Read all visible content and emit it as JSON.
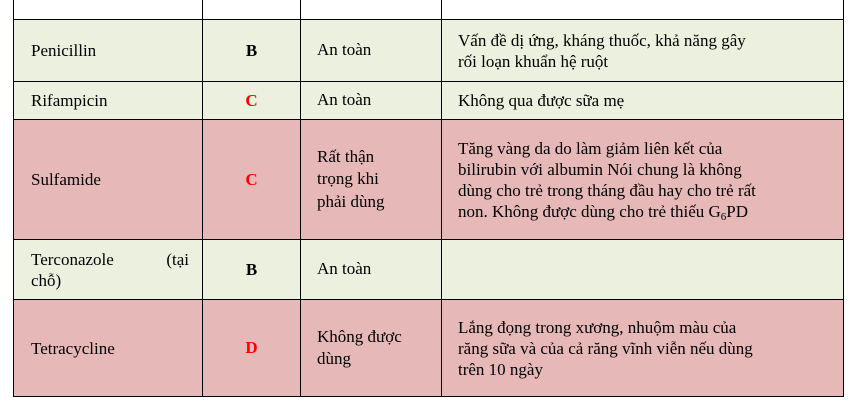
{
  "theme": {
    "green_row": "#ebf1de",
    "pink_row": "#e6b9b8",
    "category_black": "#000000",
    "category_red": "#ff0000"
  },
  "table": {
    "rows": [
      {
        "drug": [
          "Penicillin"
        ],
        "category": "B",
        "category_color": "#000000",
        "safety": [
          "An toàn"
        ],
        "notes": [
          "Vấn đề dị ứng, kháng thuốc, khả năng gây",
          "rối loạn khuẩn hệ ruột"
        ],
        "row_color": "#ebf1de"
      },
      {
        "drug": [
          "Rifampicin"
        ],
        "category": "C",
        "category_color": "#ff0000",
        "safety": [
          "An toàn"
        ],
        "notes": [
          "Không qua được sữa mẹ"
        ],
        "row_color": "#ebf1de"
      },
      {
        "drug": [
          "Sulfamide"
        ],
        "category": "C",
        "category_color": "#ff0000",
        "safety": [
          "Rất thận",
          "trọng khi",
          "phải dùng"
        ],
        "notes": [
          "Tăng vàng da do làm giảm liên kết của",
          "bilirubin với albumin Nói chung là không",
          "dùng cho trẻ trong tháng đầu hay cho trẻ rất",
          "non. Không được dùng cho trẻ thiếu G"
        ],
        "notes_subscript": "6",
        "notes_tail": "PD",
        "row_color": "#e6b9b8"
      },
      {
        "drug": [
          "Terconazole (tại",
          "chỗ)"
        ],
        "category": "B",
        "category_color": "#000000",
        "safety": [
          "An toàn"
        ],
        "notes": [],
        "row_color": "#ebf1de"
      },
      {
        "drug": [
          "Tetracycline"
        ],
        "category": "D",
        "category_color": "#ff0000",
        "safety": [
          "Không được",
          "dùng"
        ],
        "notes": [
          "Lắng đọng trong xương, nhuộm màu của",
          "răng sữa và của cả răng vĩnh viễn nếu dùng",
          "trên 10 ngày"
        ],
        "row_color": "#e6b9b8"
      }
    ]
  }
}
